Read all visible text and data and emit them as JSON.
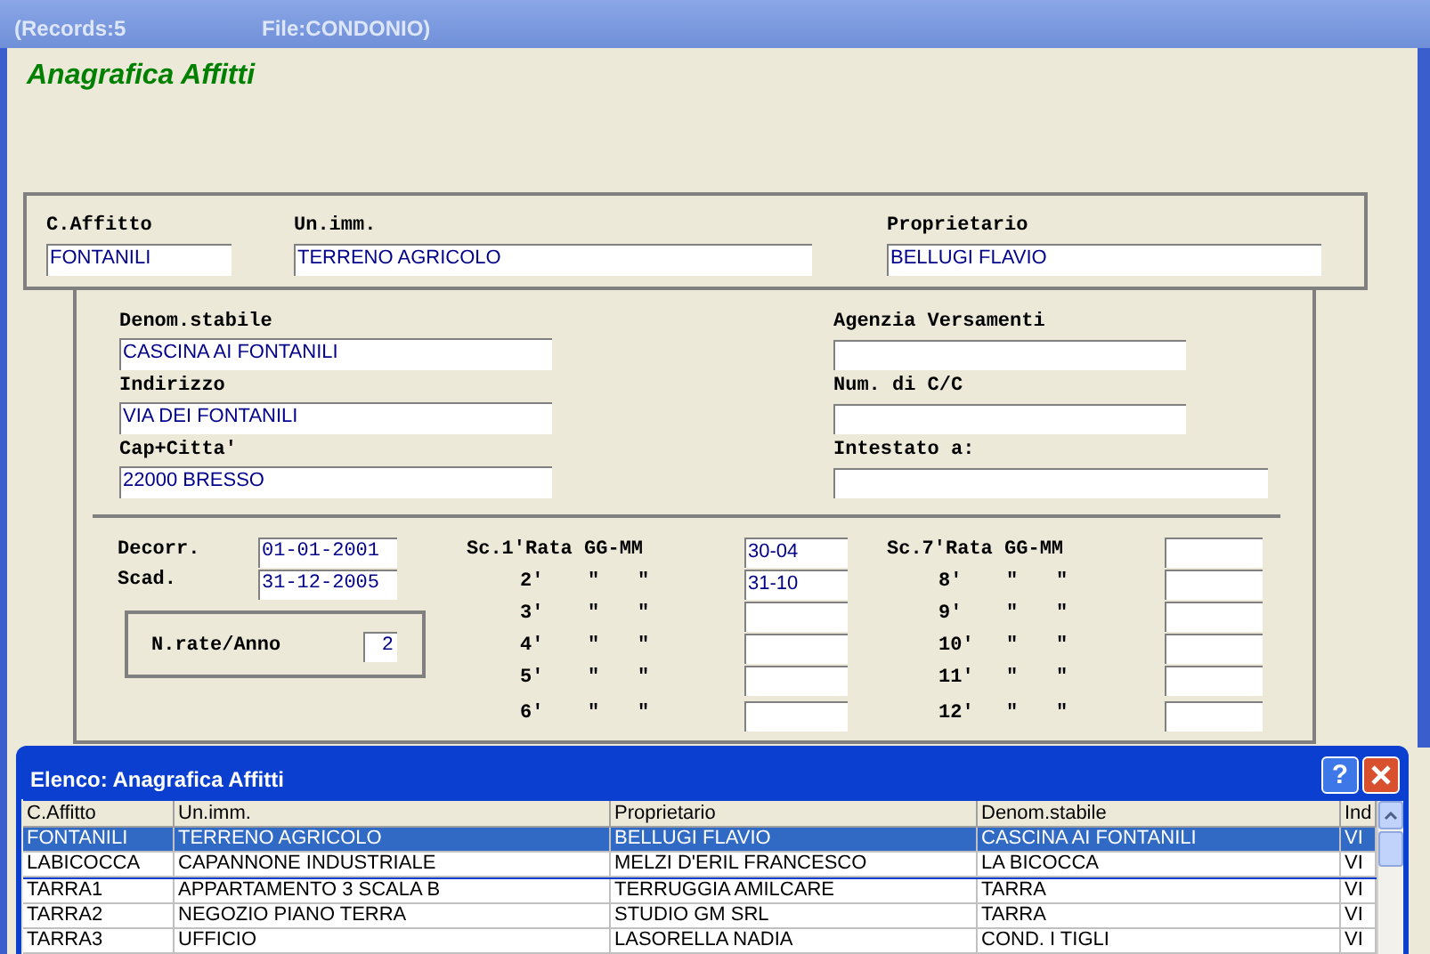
{
  "window": {
    "records": "(Records:5",
    "file": "File:CONDONIO)"
  },
  "heading": "Anagrafica Affitti",
  "main_fields": [
    {
      "label": "C.Affitto",
      "value": "FONTANILI"
    },
    {
      "label": "Un.imm.",
      "value": "TERRENO AGRICOLO"
    },
    {
      "label": "Proprietario",
      "value": "BELLUGI FLAVIO"
    }
  ],
  "building_fields": [
    {
      "label": "Denom.stabile",
      "value": "CASCINA AI FONTANILI"
    },
    {
      "label": "Indirizzo",
      "value": "VIA DEI FONTANILI"
    },
    {
      "label": "Cap+Citta'",
      "value": "22000 BRESSO"
    }
  ],
  "payment_fields": [
    {
      "label": "Agenzia Versamenti"
    },
    {
      "label": "Num. di C/C"
    },
    {
      "label": "Intestato a:"
    }
  ],
  "dates": [
    {
      "label": "Decorr.",
      "value": "01-01-2001"
    },
    {
      "label": "Scad.",
      "value": "31-12-2005"
    }
  ],
  "rate_count": {
    "label": "N.rate/Anno",
    "value": "2"
  },
  "installments_left": [
    {
      "kind": "header",
      "label": "Sc.1'Rata GG-MM",
      "value": "30-04"
    },
    {
      "kind": "ditto",
      "number": "2'",
      "marks": [
        "\"",
        "\""
      ],
      "value": "31-10"
    },
    {
      "kind": "ditto",
      "number": "3'",
      "marks": [
        "\"",
        "\""
      ]
    },
    {
      "kind": "ditto",
      "number": "4'",
      "marks": [
        "\"",
        "\""
      ]
    },
    {
      "kind": "ditto",
      "number": "5'",
      "marks": [
        "\"",
        "\""
      ]
    },
    {
      "kind": "ditto",
      "number": "6'",
      "marks": [
        "\"",
        "\""
      ]
    }
  ],
  "installments_right": [
    {
      "kind": "header",
      "label": "Sc.7'Rata GG-MM"
    },
    {
      "kind": "ditto",
      "number": "8'",
      "marks": [
        "\"",
        "\""
      ]
    },
    {
      "kind": "ditto",
      "number": "9'",
      "marks": [
        "\"",
        "\""
      ]
    },
    {
      "kind": "ditto",
      "number": "10'",
      "marks": [
        "\"",
        "\""
      ]
    },
    {
      "kind": "ditto",
      "number": "11'",
      "marks": [
        "\"",
        "\""
      ]
    },
    {
      "kind": "ditto",
      "number": "12'",
      "marks": [
        "\"",
        "\""
      ]
    }
  ],
  "list_dialog": {
    "title": "Elenco: Anagrafica Affitti",
    "help_button": "?",
    "columns": [
      "C.Affitto",
      "Un.imm.",
      "Proprietario",
      "Denom.stabile",
      "Ind"
    ],
    "rows": [
      {
        "selected": true,
        "cells": [
          "FONTANILI",
          "TERRENO AGRICOLO",
          "BELLUGI FLAVIO",
          "CASCINA AI FONTANILI",
          "VI"
        ]
      },
      {
        "selected": false,
        "cells": [
          "LABICOCCA",
          "CAPANNONE INDUSTRIALE",
          "MELZI D'ERIL FRANCESCO",
          "LA BICOCCA",
          "VI"
        ]
      },
      {
        "selected": false,
        "cells": [
          "TARRA1",
          "APPARTAMENTO 3 SCALA B",
          "TERRUGGIA AMILCARE",
          "TARRA",
          "VI"
        ]
      },
      {
        "selected": false,
        "cells": [
          "TARRA2",
          "NEGOZIO PIANO TERRA",
          "STUDIO GM SRL",
          "TARRA",
          "VI"
        ]
      },
      {
        "selected": false,
        "cells": [
          "TARRA3",
          "UFFICIO",
          "LASORELLA NADIA",
          "COND. I TIGLI",
          "VI"
        ]
      }
    ]
  }
}
